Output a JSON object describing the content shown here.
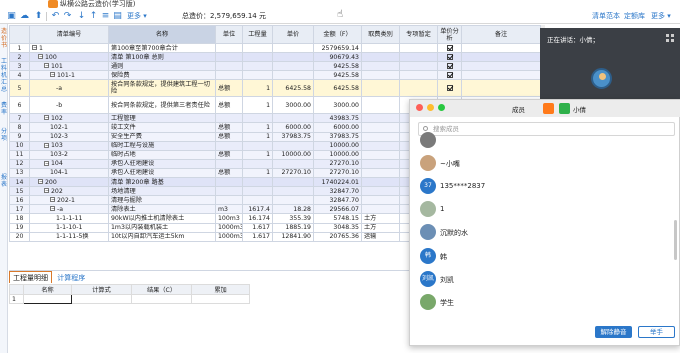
{
  "app": {
    "title": "纵横公路云造价(学习版)"
  },
  "toolbar": {
    "more_label": "更多",
    "total_text": "总造价：2,579,659.14 元",
    "right_items": [
      "清单范本",
      "定额库",
      "更多"
    ]
  },
  "sidetabs": [
    "造价书",
    "工料机汇总",
    "费率",
    "分项",
    "报表"
  ],
  "grid": {
    "columns": [
      "",
      "清单编号",
      "名称",
      "单位",
      "工程量",
      "单价",
      "金额（F）",
      "取费类别",
      "专项暂定",
      "单价分析",
      "备注"
    ],
    "rows": [
      {
        "n": "1",
        "code": "1",
        "name": "第100章至第700章合计",
        "unit": "",
        "qty": "",
        "price": "",
        "amount": "2579659.14",
        "fee": "",
        "spec": "",
        "chk": "on",
        "level": "lv0",
        "toggle": "−",
        "indent": 0
      },
      {
        "n": "2",
        "code": "100",
        "name": "清单 第100章 总则",
        "unit": "",
        "qty": "",
        "price": "",
        "amount": "90679.43",
        "fee": "",
        "spec": "",
        "chk": "on",
        "level": "lv1",
        "toggle": "−",
        "indent": 1
      },
      {
        "n": "3",
        "code": "101",
        "name": "通则",
        "unit": "",
        "qty": "",
        "price": "",
        "amount": "9425.58",
        "fee": "",
        "spec": "",
        "chk": "on",
        "level": "lv2",
        "toggle": "−",
        "indent": 2
      },
      {
        "n": "4",
        "code": "101-1",
        "name": "保险费",
        "unit": "",
        "qty": "",
        "price": "",
        "amount": "9425.58",
        "fee": "",
        "spec": "",
        "chk": "on",
        "level": "lv3",
        "toggle": "−",
        "indent": 3
      },
      {
        "n": "5",
        "code": "-a",
        "name": "按合同条款规定，提供建筑工程一切险",
        "unit": "总额",
        "qty": "1",
        "price": "6425.58",
        "amount": "6425.58",
        "fee": "",
        "spec": "",
        "chk": "on",
        "level": "sel tall",
        "toggle": "",
        "indent": 4
      },
      {
        "n": "6",
        "code": "-b",
        "name": "按合同条款规定，提供第三者责任险",
        "unit": "总额",
        "qty": "1",
        "price": "3000.00",
        "amount": "3000.00",
        "fee": "",
        "spec": "",
        "chk": "on",
        "level": "plain tall",
        "toggle": "",
        "indent": 4
      },
      {
        "n": "7",
        "code": "102",
        "name": "工程管理",
        "unit": "",
        "qty": "",
        "price": "",
        "amount": "43983.75",
        "fee": "",
        "spec": "",
        "chk": "on",
        "level": "lv2",
        "toggle": "−",
        "indent": 2
      },
      {
        "n": "8",
        "code": "102-1",
        "name": "竣工文件",
        "unit": "总额",
        "qty": "1",
        "price": "6000.00",
        "amount": "6000.00",
        "fee": "",
        "spec": "",
        "chk": "on",
        "level": "lv3",
        "toggle": "",
        "indent": 3
      },
      {
        "n": "9",
        "code": "102-3",
        "name": "安全生产费",
        "unit": "总额",
        "qty": "1",
        "price": "37983.75",
        "amount": "37983.75",
        "fee": "",
        "spec": "",
        "chk": "on",
        "level": "lv3",
        "toggle": "",
        "indent": 3
      },
      {
        "n": "10",
        "code": "103",
        "name": "临时工程与设施",
        "unit": "",
        "qty": "",
        "price": "",
        "amount": "10000.00",
        "fee": "",
        "spec": "",
        "chk": "on",
        "level": "lv2",
        "toggle": "−",
        "indent": 2
      },
      {
        "n": "11",
        "code": "103-2",
        "name": "临时占地",
        "unit": "总额",
        "qty": "1",
        "price": "10000.00",
        "amount": "10000.00",
        "fee": "",
        "spec": "",
        "chk": "on",
        "level": "lv3",
        "toggle": "",
        "indent": 3
      },
      {
        "n": "12",
        "code": "104",
        "name": "承包人驻地建设",
        "unit": "",
        "qty": "",
        "price": "",
        "amount": "27270.10",
        "fee": "",
        "spec": "",
        "chk": "on",
        "level": "lv2",
        "toggle": "−",
        "indent": 2
      },
      {
        "n": "13",
        "code": "104-1",
        "name": "承包人驻地建设",
        "unit": "总额",
        "qty": "1",
        "price": "27270.10",
        "amount": "27270.10",
        "fee": "",
        "spec": "",
        "chk": "on",
        "level": "lv3",
        "toggle": "",
        "indent": 3
      },
      {
        "n": "14",
        "code": "200",
        "name": "清单 第200章 路基",
        "unit": "",
        "qty": "",
        "price": "",
        "amount": "1740224.01",
        "fee": "",
        "spec": "",
        "chk": "on",
        "level": "lv1",
        "toggle": "−",
        "indent": 1
      },
      {
        "n": "15",
        "code": "202",
        "name": "场地清理",
        "unit": "",
        "qty": "",
        "price": "",
        "amount": "32847.70",
        "fee": "",
        "spec": "",
        "chk": "on",
        "level": "lv2",
        "toggle": "−",
        "indent": 2
      },
      {
        "n": "16",
        "code": "202-1",
        "name": "清理与掘除",
        "unit": "",
        "qty": "",
        "price": "",
        "amount": "32847.70",
        "fee": "",
        "spec": "",
        "chk": "on",
        "level": "lv3",
        "toggle": "−",
        "indent": 3
      },
      {
        "n": "17",
        "code": "-a",
        "name": "清除表土",
        "unit": "m3",
        "qty": "1617.4",
        "price": "18.28",
        "amount": "29566.07",
        "fee": "",
        "spec": "",
        "chk": "on",
        "level": "lv3",
        "toggle": "−",
        "indent": 3
      },
      {
        "n": "18",
        "code": "1-1-1-11",
        "name": "90kW以内推土机清除表土",
        "unit": "100m3",
        "qty": "16.174",
        "price": "355.39",
        "amount": "5748.15",
        "fee": "土方",
        "spec": "",
        "chk": "",
        "level": "plain",
        "toggle": "",
        "indent": 4
      },
      {
        "n": "19",
        "code": "1-1-10-1",
        "name": "1m3以内装载机装土",
        "unit": "1000m3天然密",
        "qty": "1.617",
        "price": "1885.19",
        "amount": "3048.35",
        "fee": "土方",
        "spec": "",
        "chk": "",
        "level": "plain",
        "toggle": "",
        "indent": 4
      },
      {
        "n": "20",
        "code": "1-1-11-5换",
        "name": "10t以内自卸汽车运土5km",
        "unit": "1000m3天然密",
        "qty": "1.617",
        "price": "12841.90",
        "amount": "20765.36",
        "fee": "运输",
        "spec": "",
        "chk": "",
        "level": "plain",
        "toggle": "",
        "indent": 4
      }
    ]
  },
  "bottom": {
    "tabs": [
      "工程量明细",
      "计算程序"
    ],
    "columns": [
      "名称",
      "计算式",
      "结果（C）",
      "累加"
    ]
  },
  "voice_panel": {
    "title": "正在讲话：小倩；"
  },
  "members": {
    "header_tag": "成员",
    "speaker": "小倩",
    "search_placeholder": "搜索成员",
    "list": [
      {
        "name": "",
        "avatar_text": "",
        "color": "#7a7a7a"
      },
      {
        "name": "~小嘴",
        "avatar_text": "",
        "color": "#c9a27c"
      },
      {
        "name": "135****2837",
        "avatar_text": "37",
        "color": "#2b77c9"
      },
      {
        "name": "1",
        "avatar_text": "",
        "color": "#a5b8a0"
      },
      {
        "name": "沉默的水",
        "avatar_text": "",
        "color": "#6c8fb5"
      },
      {
        "name": "韩",
        "avatar_text": "韩",
        "color": "#2b77c9"
      },
      {
        "name": "刘凯",
        "avatar_text": "刘凯",
        "color": "#2b77c9"
      },
      {
        "name": "学生",
        "avatar_text": "",
        "color": "#79a86a"
      }
    ],
    "unmute_label": "解除静音",
    "raise_label": "举手"
  }
}
